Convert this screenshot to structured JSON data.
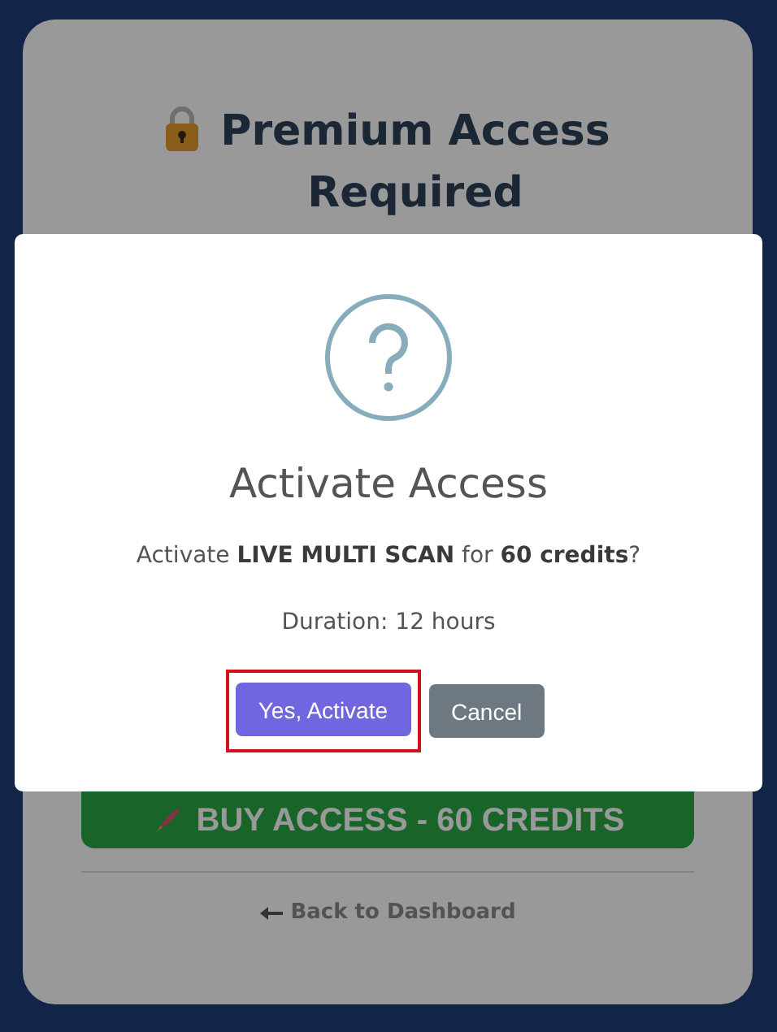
{
  "page": {
    "title": "Premium Access Required",
    "buy_button": {
      "label": "BUY ACCESS - 60 CREDITS"
    },
    "back_link": {
      "label": "Back to Dashboard"
    }
  },
  "dialog": {
    "title": "Activate Access",
    "message": "Activate **LIVE MULTI SCAN** for **60 credits**?",
    "duration": "Duration: 12 hours",
    "buttons": [
      {
        "label": "Yes, Activate",
        "kind": "confirm",
        "highlighted": true
      },
      {
        "label": "Cancel",
        "kind": "cancel",
        "highlighted": false
      }
    ]
  }
}
